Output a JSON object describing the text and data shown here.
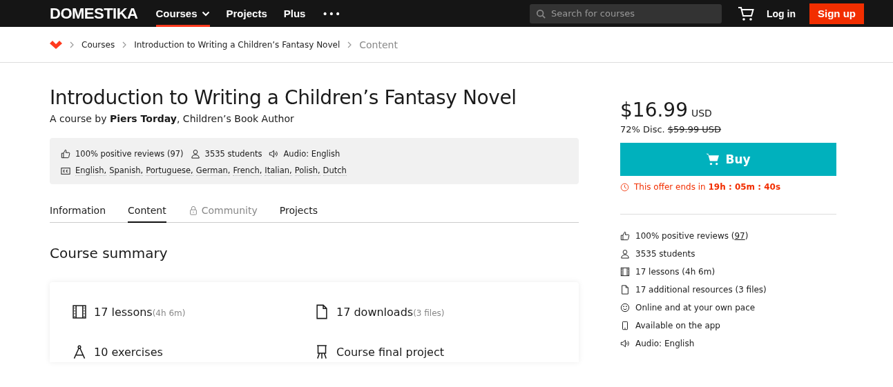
{
  "nav": {
    "logo": "DOMESTIKA",
    "items": [
      {
        "label": "Courses",
        "selected": true,
        "dropdown": true
      },
      {
        "label": "Projects",
        "selected": false,
        "dropdown": false
      },
      {
        "label": "Plus",
        "selected": false,
        "dropdown": false
      }
    ],
    "more": "•••",
    "search": {
      "placeholder": "Search for courses"
    },
    "login": "Log in",
    "signup": "Sign up"
  },
  "breadcrumb": [
    {
      "label": "Courses",
      "current": false
    },
    {
      "label": "Introduction to Writing a Children’s Fantasy Novel",
      "current": false
    },
    {
      "label": "Content",
      "current": true
    }
  ],
  "course": {
    "title": "Introduction to Writing a Children’s Fantasy Novel",
    "byline": "A course by **Piers Torday**, Children’s Book Author"
  },
  "stats": [
    {
      "kind": "thumb",
      "text": "100% positive reviews (97)"
    },
    {
      "kind": "user",
      "text": "3535 students"
    },
    {
      "kind": "audio",
      "text": "Audio: English"
    }
  ],
  "subtitles": {
    "kind": "cc",
    "languages": [
      "English,",
      "Spanish,",
      "Portuguese,",
      "German,",
      "French,",
      "Italian,",
      "Polish,",
      "Dutch"
    ]
  },
  "tabs": [
    {
      "label": "Information",
      "selected": false,
      "locked": false
    },
    {
      "label": "Content",
      "selected": true,
      "locked": false
    },
    {
      "label": "Community",
      "selected": false,
      "locked": true
    },
    {
      "label": "Projects",
      "selected": false,
      "locked": false
    }
  ],
  "summary": {
    "title": "Course summary",
    "items": [
      {
        "kind": "film",
        "text": "17 lessons",
        "note": "(4h 6m)"
      },
      {
        "kind": "file",
        "text": "17 downloads",
        "note": "(3 files)"
      },
      {
        "kind": "compass",
        "text": "10 exercises"
      },
      {
        "kind": "easel",
        "text": "Course final project"
      }
    ]
  },
  "price": {
    "amount": "$16.99",
    "currency": "USD",
    "discount": "72% Disc.",
    "original": "$59.99 USD",
    "buy": "Buy",
    "offer": "This offer ends in",
    "countdown": "19h : 05m : 40s"
  },
  "features": [
    {
      "kind": "thumb",
      "text": "100% positive reviews (",
      "link": "97",
      "after": ")"
    },
    {
      "kind": "user",
      "text": "3535 students"
    },
    {
      "kind": "film",
      "text": "17 lessons (4h 6m)"
    },
    {
      "kind": "file",
      "text": "17 additional resources (3 files)"
    },
    {
      "kind": "smile",
      "text": "Online and at your own pace"
    },
    {
      "kind": "phone",
      "text": "Available on the app"
    },
    {
      "kind": "audio",
      "text": "Audio: English"
    }
  ]
}
